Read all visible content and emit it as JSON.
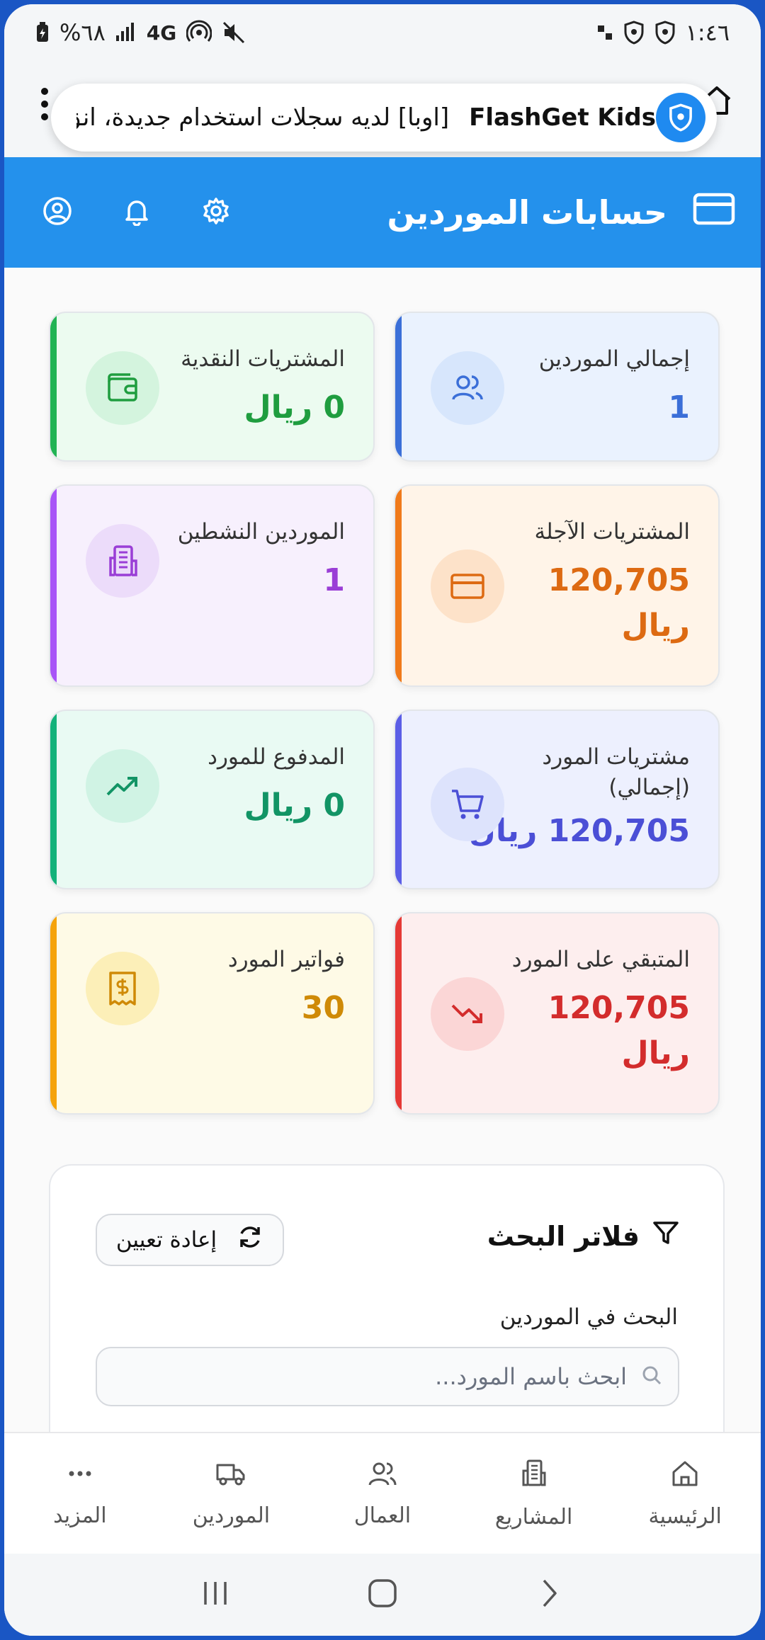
{
  "status_bar": {
    "battery": "%٦٨",
    "network": "4G",
    "time": "١:٤٦"
  },
  "notification": {
    "app_name": "FlashGet Kids",
    "message": "[اوبا] لديه سجلات استخدام جديدة، انق..."
  },
  "header": {
    "title": "حسابات الموردين"
  },
  "stats": [
    {
      "label": "إجمالي الموردين",
      "value": "1",
      "color": "#3b6fd8",
      "bg": "#eaf2fe",
      "icon": "users-icon"
    },
    {
      "label": "المشتريات النقدية",
      "value": "0 ريال",
      "color": "#1f9d3f",
      "bg": "#ecfbf0",
      "icon": "wallet-icon"
    },
    {
      "label": "المشتريات الآجلة",
      "value": "120,705 ريال",
      "color": "#dd6a12",
      "bg": "#fff4e8",
      "icon": "credit-card-icon"
    },
    {
      "label": "الموردين النشطين",
      "value": "1",
      "color": "#9a3ed6",
      "bg": "#f7f0fd",
      "icon": "building-icon"
    },
    {
      "label": "مشتريات المورد (إجمالي)",
      "value": "120,705 ريال",
      "color": "#4b4fd6",
      "bg": "#edf0fe",
      "icon": "cart-icon"
    },
    {
      "label": "المدفوع للمورد",
      "value": "0 ريال",
      "color": "#129465",
      "bg": "#e9faf3",
      "icon": "trending-up-icon"
    },
    {
      "label": "المتبقي على المورد",
      "value": "120,705 ريال",
      "color": "#d32c2c",
      "bg": "#fdeeee",
      "icon": "trending-down-icon"
    },
    {
      "label": "فواتير المورد",
      "value": "30",
      "color": "#cf8a07",
      "bg": "#fefae6",
      "icon": "receipt-icon"
    }
  ],
  "filters": {
    "title": "فلاتر البحث",
    "reset_label": "إعادة تعيين",
    "search_label": "البحث في الموردين",
    "search_placeholder": "ابحث باسم المورد..."
  },
  "bottom_nav": [
    {
      "label": "المزيد",
      "icon": "more-icon"
    },
    {
      "label": "الموردين",
      "icon": "truck-icon"
    },
    {
      "label": "العمال",
      "icon": "users-icon"
    },
    {
      "label": "المشاريع",
      "icon": "building-icon"
    },
    {
      "label": "الرئيسية",
      "icon": "home-icon"
    }
  ],
  "accent_color": "#2491ec"
}
